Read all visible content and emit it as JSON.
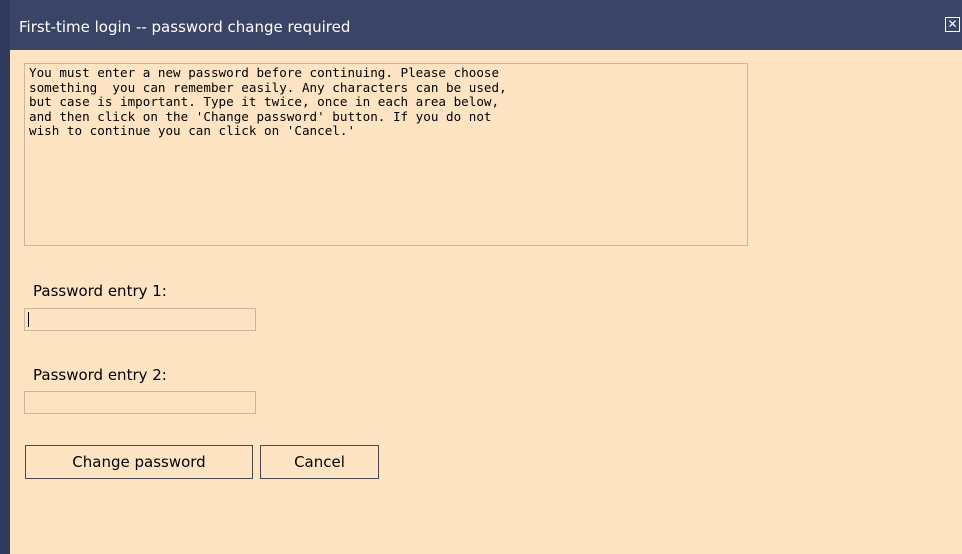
{
  "dialog": {
    "title": "First-time login -- password change required",
    "close_label": "✕",
    "message": "You must enter a new password before continuing. Please choose\nsomething  you can remember easily. Any characters can be used,\nbut case is important. Type it twice, once in each area below,\nand then click on the 'Change password' button. If you do not\nwish to continue you can click on 'Cancel.'",
    "password1": {
      "label": "Password entry 1:",
      "value": "",
      "focused": true
    },
    "password2": {
      "label": "Password entry 2:",
      "value": ""
    },
    "buttons": {
      "change_label": "Change password",
      "cancel_label": "Cancel"
    },
    "colors": {
      "title_bar": "#3a4466",
      "body_background": "#ffe4c4",
      "left_border": "#2e3a5e",
      "title_text": "#ffffff"
    },
    "icons": {
      "close": "close-icon"
    }
  }
}
